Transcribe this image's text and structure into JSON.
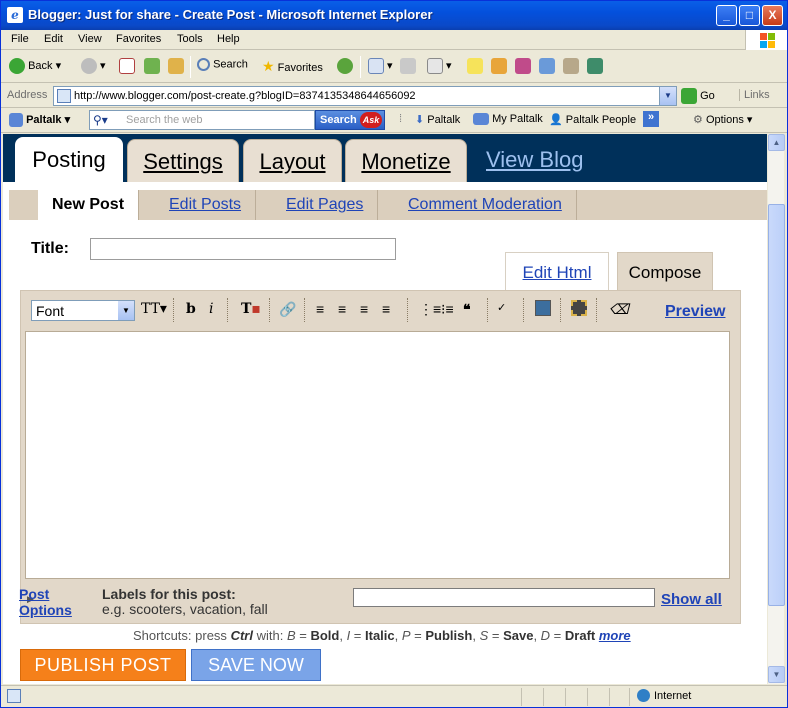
{
  "window": {
    "title": "Blogger: Just for share - Create Post - Microsoft Internet Explorer",
    "minimize": "_",
    "maximize": "□",
    "close": "X"
  },
  "menu": [
    "File",
    "Edit",
    "View",
    "Favorites",
    "Tools",
    "Help"
  ],
  "toolbar": {
    "back": "Back",
    "search": "Search",
    "favorites": "Favorites"
  },
  "address": {
    "label": "Address",
    "url": "http://www.blogger.com/post-create.g?blogID=8374135348644656092",
    "go": "Go",
    "links": "Links"
  },
  "paltalk_bar": {
    "brand": "Paltalk",
    "search_placeholder": "Search the web",
    "search_button": "Search",
    "ask": "Ask",
    "items": [
      "Paltalk",
      "My Paltalk",
      "Paltalk People"
    ],
    "options": "Options"
  },
  "blogger": {
    "tabs": [
      "Posting",
      "Settings",
      "Layout",
      "Monetize"
    ],
    "view_blog": "View Blog",
    "subnav": [
      "New Post",
      "Edit Posts",
      "Edit Pages",
      "Comment Moderation"
    ],
    "title_label": "Title:",
    "mode_tabs": {
      "edit_html": "Edit Html",
      "compose": "Compose"
    },
    "editor": {
      "font": "Font",
      "preview": "Preview"
    },
    "post_options": "Post Options",
    "labels_label": "Labels for this post:",
    "labels_example": "e.g. scooters, vacation, fall",
    "show_all": "Show all",
    "shortcuts": {
      "prefix": "Shortcuts: press",
      "key": "Ctrl",
      "with": "with:",
      "b": "B",
      "bold": "Bold",
      "i": "I",
      "italic": "Italic",
      "p": "P",
      "publish": "Publish",
      "s": "S",
      "save": "Save",
      "d": "D",
      "draft": "Draft",
      "more": "more"
    },
    "publish_button": "PUBLISH POST",
    "save_button": "SAVE NOW"
  },
  "status": {
    "zone": "Internet"
  },
  "colors": {
    "nav": "#00305a",
    "tab": "#e8dfd2",
    "publish": "#f5801a",
    "save": "#7aa4e8",
    "link": "#1f44b7"
  }
}
